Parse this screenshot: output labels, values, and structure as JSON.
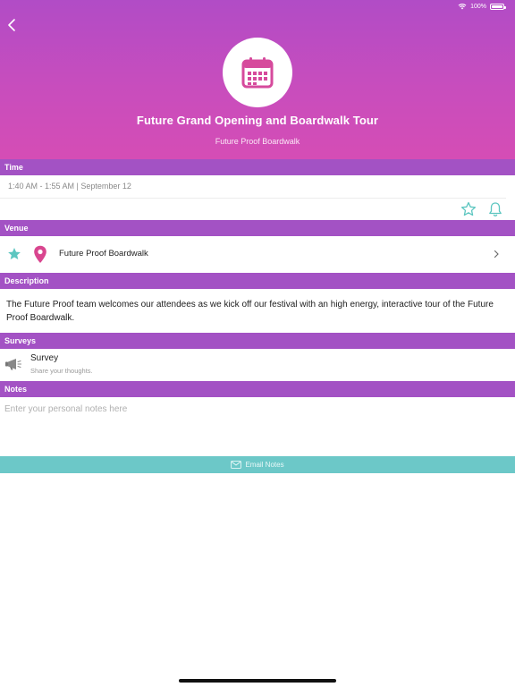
{
  "status_bar": {
    "battery_percent": "100%"
  },
  "header": {
    "title": "Future Grand Opening and Boardwalk Tour",
    "subtitle": "Future Proof Boardwalk",
    "gradient_colors": [
      "#b14cc6",
      "#d54db5"
    ],
    "icon": "calendar-icon"
  },
  "sections": {
    "time": "Time",
    "venue": "Venue",
    "description": "Description",
    "surveys": "Surveys",
    "notes": "Notes"
  },
  "time": {
    "text": "1:40 AM - 1:55 AM | September 12",
    "actions": [
      "star-outline-icon",
      "bell-icon"
    ]
  },
  "venue": {
    "name": "Future Proof Boardwalk",
    "favorite_color": "#5cc6c0",
    "pin_color": "#d9468f"
  },
  "description": {
    "text": "The Future Proof team welcomes our attendees as we kick off our festival with an high energy, interactive tour of the Future Proof Boardwalk."
  },
  "survey": {
    "title": "Survey",
    "subtitle": "Share your thoughts."
  },
  "notes": {
    "placeholder": "Enter your personal notes here",
    "email_button_label": "Email Notes"
  },
  "colors": {
    "section_header": "#a352c4",
    "accent_teal": "#6cc8c8"
  }
}
